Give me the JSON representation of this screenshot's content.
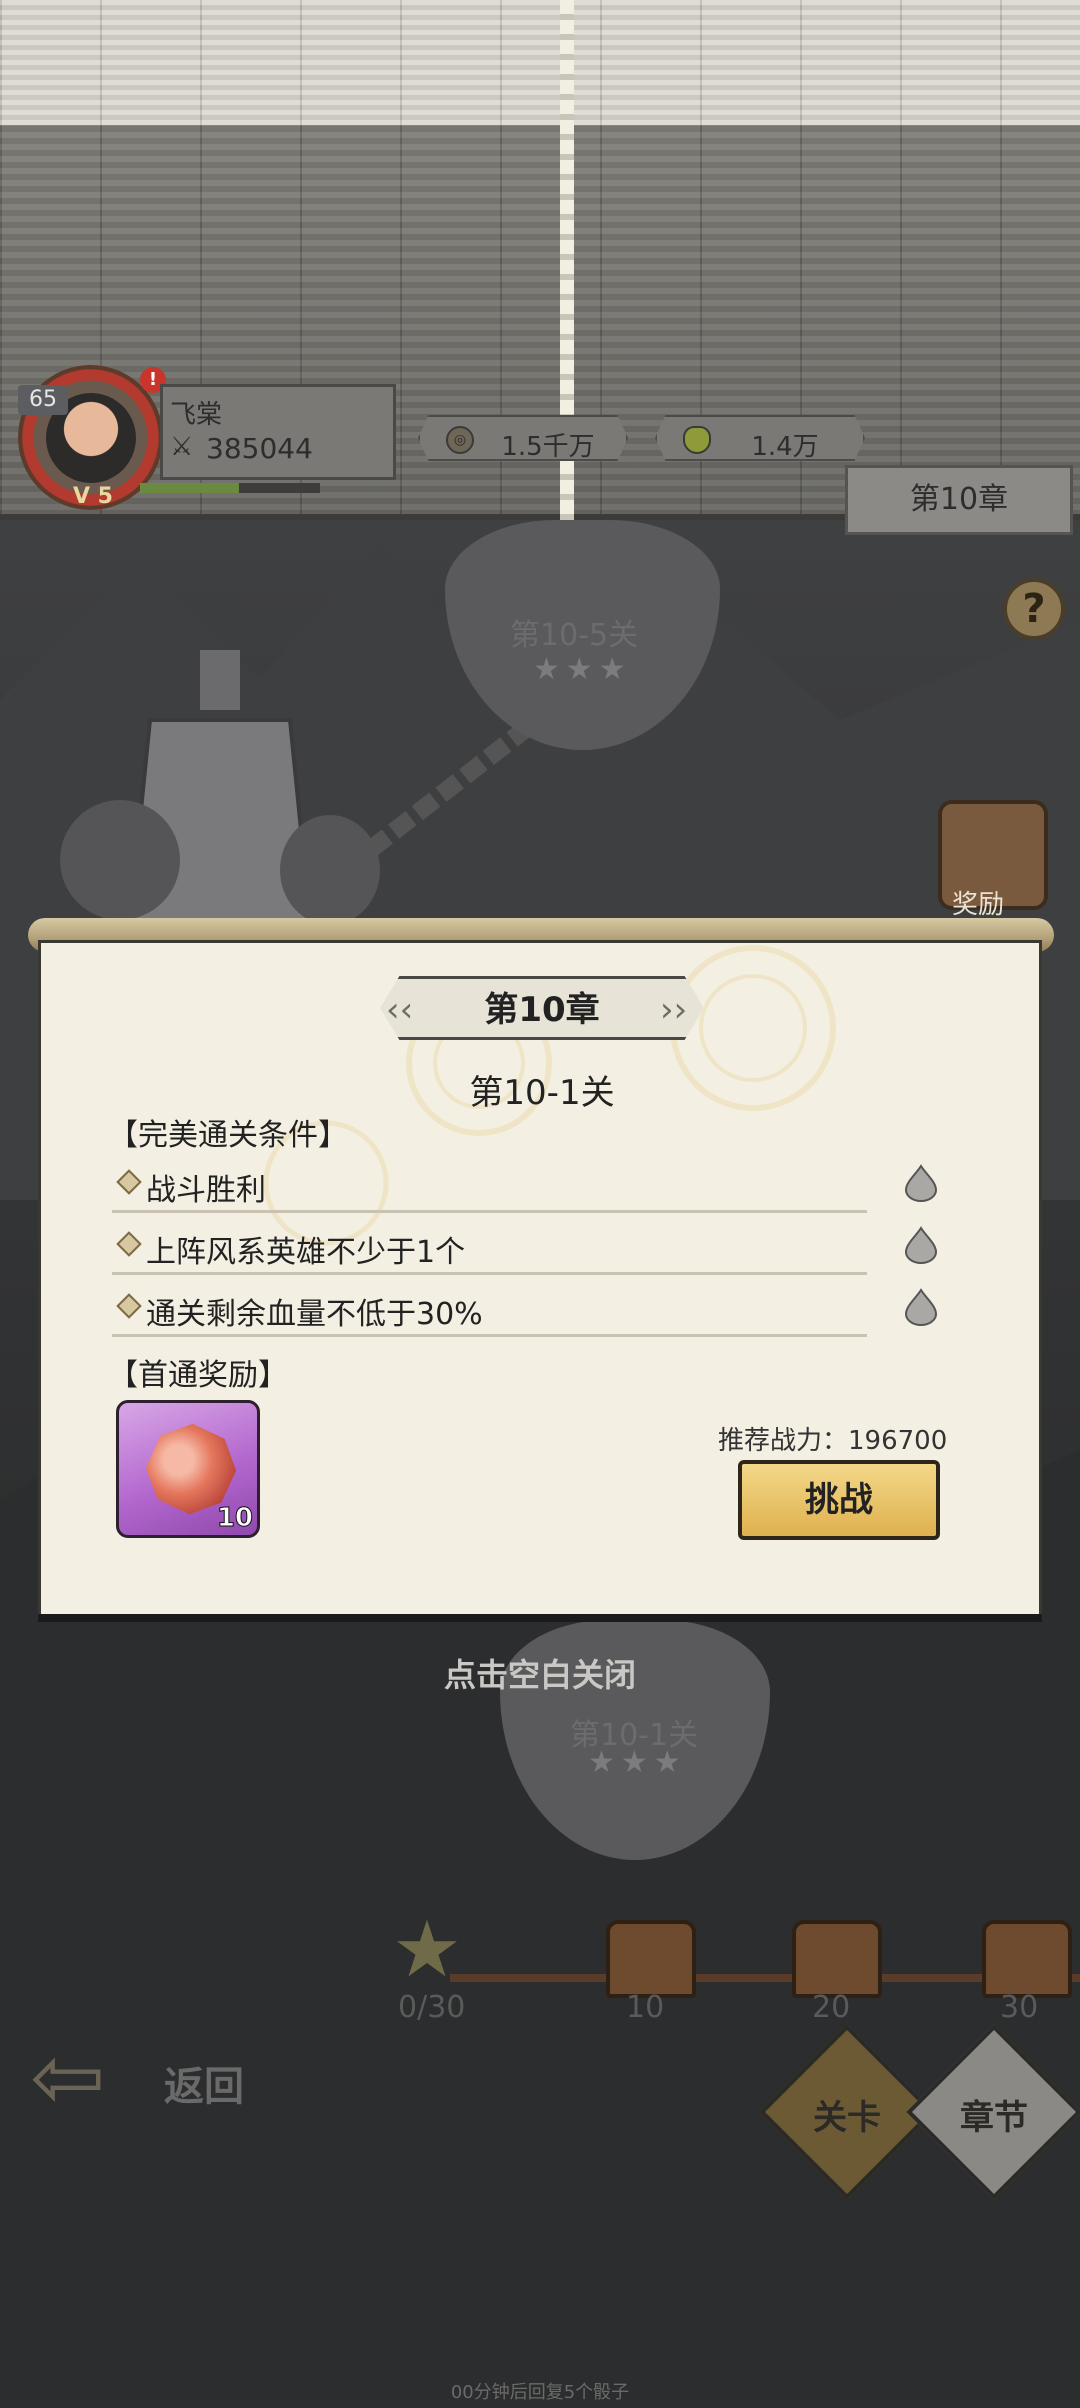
{
  "player": {
    "level": "65",
    "vip": "V 5",
    "alert": "!",
    "name": "飞棠",
    "power": "385044",
    "exp_fraction": 0.55
  },
  "currencies": [
    {
      "name": "coin",
      "value": "1.5千万"
    },
    {
      "name": "ingot",
      "value": "1.4万"
    }
  ],
  "chapter_tag": "第10章",
  "help_label": "?",
  "map": {
    "top_stage": {
      "label": "第10-5关",
      "stars": "★★★"
    },
    "bottom_stage": {
      "label": "第10-1关",
      "stars": "★★★"
    },
    "reward_button_label": "奖励"
  },
  "modal": {
    "chapter_title": "第10章",
    "stage_title": "第10-1关",
    "conditions_title": "【完美通关条件】",
    "conditions": [
      "战斗胜利",
      "上阵风系英雄不少于1个",
      "通关剩余血量不低于30%"
    ],
    "reward_title": "【首通奖励】",
    "reward_count": "10",
    "recommended_power": "推荐战力：196700",
    "challenge_label": "挑战"
  },
  "close_hint": "点击空白关闭",
  "progress": {
    "star_count": "0/30",
    "milestones": [
      "10",
      "20",
      "30"
    ]
  },
  "nav": {
    "back_label": "返回",
    "tab_stage": "关卡",
    "tab_chapter": "章节"
  },
  "footer_note": "00分钟后回复5个骰子",
  "colors": {
    "modal_bg": "#f3efe3",
    "challenge_button": "#dfb14f",
    "reward_item_bg": "#b468cf"
  }
}
